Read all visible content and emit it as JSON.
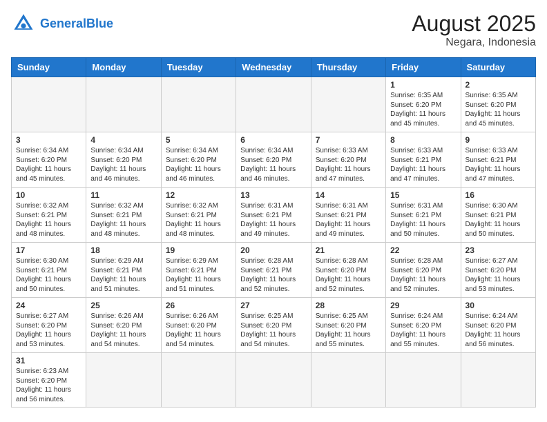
{
  "header": {
    "logo_general": "General",
    "logo_blue": "Blue",
    "month_year": "August 2025",
    "location": "Negara, Indonesia"
  },
  "weekdays": [
    "Sunday",
    "Monday",
    "Tuesday",
    "Wednesday",
    "Thursday",
    "Friday",
    "Saturday"
  ],
  "weeks": [
    [
      {
        "day": "",
        "sunrise": "",
        "sunset": "",
        "daylight": "",
        "empty": true
      },
      {
        "day": "",
        "sunrise": "",
        "sunset": "",
        "daylight": "",
        "empty": true
      },
      {
        "day": "",
        "sunrise": "",
        "sunset": "",
        "daylight": "",
        "empty": true
      },
      {
        "day": "",
        "sunrise": "",
        "sunset": "",
        "daylight": "",
        "empty": true
      },
      {
        "day": "",
        "sunrise": "",
        "sunset": "",
        "daylight": "",
        "empty": true
      },
      {
        "day": "1",
        "sunrise": "Sunrise: 6:35 AM",
        "sunset": "Sunset: 6:20 PM",
        "daylight": "Daylight: 11 hours and 45 minutes.",
        "empty": false
      },
      {
        "day": "2",
        "sunrise": "Sunrise: 6:35 AM",
        "sunset": "Sunset: 6:20 PM",
        "daylight": "Daylight: 11 hours and 45 minutes.",
        "empty": false
      }
    ],
    [
      {
        "day": "3",
        "sunrise": "Sunrise: 6:34 AM",
        "sunset": "Sunset: 6:20 PM",
        "daylight": "Daylight: 11 hours and 45 minutes.",
        "empty": false
      },
      {
        "day": "4",
        "sunrise": "Sunrise: 6:34 AM",
        "sunset": "Sunset: 6:20 PM",
        "daylight": "Daylight: 11 hours and 46 minutes.",
        "empty": false
      },
      {
        "day": "5",
        "sunrise": "Sunrise: 6:34 AM",
        "sunset": "Sunset: 6:20 PM",
        "daylight": "Daylight: 11 hours and 46 minutes.",
        "empty": false
      },
      {
        "day": "6",
        "sunrise": "Sunrise: 6:34 AM",
        "sunset": "Sunset: 6:20 PM",
        "daylight": "Daylight: 11 hours and 46 minutes.",
        "empty": false
      },
      {
        "day": "7",
        "sunrise": "Sunrise: 6:33 AM",
        "sunset": "Sunset: 6:20 PM",
        "daylight": "Daylight: 11 hours and 47 minutes.",
        "empty": false
      },
      {
        "day": "8",
        "sunrise": "Sunrise: 6:33 AM",
        "sunset": "Sunset: 6:21 PM",
        "daylight": "Daylight: 11 hours and 47 minutes.",
        "empty": false
      },
      {
        "day": "9",
        "sunrise": "Sunrise: 6:33 AM",
        "sunset": "Sunset: 6:21 PM",
        "daylight": "Daylight: 11 hours and 47 minutes.",
        "empty": false
      }
    ],
    [
      {
        "day": "10",
        "sunrise": "Sunrise: 6:32 AM",
        "sunset": "Sunset: 6:21 PM",
        "daylight": "Daylight: 11 hours and 48 minutes.",
        "empty": false
      },
      {
        "day": "11",
        "sunrise": "Sunrise: 6:32 AM",
        "sunset": "Sunset: 6:21 PM",
        "daylight": "Daylight: 11 hours and 48 minutes.",
        "empty": false
      },
      {
        "day": "12",
        "sunrise": "Sunrise: 6:32 AM",
        "sunset": "Sunset: 6:21 PM",
        "daylight": "Daylight: 11 hours and 48 minutes.",
        "empty": false
      },
      {
        "day": "13",
        "sunrise": "Sunrise: 6:31 AM",
        "sunset": "Sunset: 6:21 PM",
        "daylight": "Daylight: 11 hours and 49 minutes.",
        "empty": false
      },
      {
        "day": "14",
        "sunrise": "Sunrise: 6:31 AM",
        "sunset": "Sunset: 6:21 PM",
        "daylight": "Daylight: 11 hours and 49 minutes.",
        "empty": false
      },
      {
        "day": "15",
        "sunrise": "Sunrise: 6:31 AM",
        "sunset": "Sunset: 6:21 PM",
        "daylight": "Daylight: 11 hours and 50 minutes.",
        "empty": false
      },
      {
        "day": "16",
        "sunrise": "Sunrise: 6:30 AM",
        "sunset": "Sunset: 6:21 PM",
        "daylight": "Daylight: 11 hours and 50 minutes.",
        "empty": false
      }
    ],
    [
      {
        "day": "17",
        "sunrise": "Sunrise: 6:30 AM",
        "sunset": "Sunset: 6:21 PM",
        "daylight": "Daylight: 11 hours and 50 minutes.",
        "empty": false
      },
      {
        "day": "18",
        "sunrise": "Sunrise: 6:29 AM",
        "sunset": "Sunset: 6:21 PM",
        "daylight": "Daylight: 11 hours and 51 minutes.",
        "empty": false
      },
      {
        "day": "19",
        "sunrise": "Sunrise: 6:29 AM",
        "sunset": "Sunset: 6:21 PM",
        "daylight": "Daylight: 11 hours and 51 minutes.",
        "empty": false
      },
      {
        "day": "20",
        "sunrise": "Sunrise: 6:28 AM",
        "sunset": "Sunset: 6:21 PM",
        "daylight": "Daylight: 11 hours and 52 minutes.",
        "empty": false
      },
      {
        "day": "21",
        "sunrise": "Sunrise: 6:28 AM",
        "sunset": "Sunset: 6:20 PM",
        "daylight": "Daylight: 11 hours and 52 minutes.",
        "empty": false
      },
      {
        "day": "22",
        "sunrise": "Sunrise: 6:28 AM",
        "sunset": "Sunset: 6:20 PM",
        "daylight": "Daylight: 11 hours and 52 minutes.",
        "empty": false
      },
      {
        "day": "23",
        "sunrise": "Sunrise: 6:27 AM",
        "sunset": "Sunset: 6:20 PM",
        "daylight": "Daylight: 11 hours and 53 minutes.",
        "empty": false
      }
    ],
    [
      {
        "day": "24",
        "sunrise": "Sunrise: 6:27 AM",
        "sunset": "Sunset: 6:20 PM",
        "daylight": "Daylight: 11 hours and 53 minutes.",
        "empty": false
      },
      {
        "day": "25",
        "sunrise": "Sunrise: 6:26 AM",
        "sunset": "Sunset: 6:20 PM",
        "daylight": "Daylight: 11 hours and 54 minutes.",
        "empty": false
      },
      {
        "day": "26",
        "sunrise": "Sunrise: 6:26 AM",
        "sunset": "Sunset: 6:20 PM",
        "daylight": "Daylight: 11 hours and 54 minutes.",
        "empty": false
      },
      {
        "day": "27",
        "sunrise": "Sunrise: 6:25 AM",
        "sunset": "Sunset: 6:20 PM",
        "daylight": "Daylight: 11 hours and 54 minutes.",
        "empty": false
      },
      {
        "day": "28",
        "sunrise": "Sunrise: 6:25 AM",
        "sunset": "Sunset: 6:20 PM",
        "daylight": "Daylight: 11 hours and 55 minutes.",
        "empty": false
      },
      {
        "day": "29",
        "sunrise": "Sunrise: 6:24 AM",
        "sunset": "Sunset: 6:20 PM",
        "daylight": "Daylight: 11 hours and 55 minutes.",
        "empty": false
      },
      {
        "day": "30",
        "sunrise": "Sunrise: 6:24 AM",
        "sunset": "Sunset: 6:20 PM",
        "daylight": "Daylight: 11 hours and 56 minutes.",
        "empty": false
      }
    ],
    [
      {
        "day": "31",
        "sunrise": "Sunrise: 6:23 AM",
        "sunset": "Sunset: 6:20 PM",
        "daylight": "Daylight: 11 hours and 56 minutes.",
        "empty": false
      },
      {
        "day": "",
        "sunrise": "",
        "sunset": "",
        "daylight": "",
        "empty": true
      },
      {
        "day": "",
        "sunrise": "",
        "sunset": "",
        "daylight": "",
        "empty": true
      },
      {
        "day": "",
        "sunrise": "",
        "sunset": "",
        "daylight": "",
        "empty": true
      },
      {
        "day": "",
        "sunrise": "",
        "sunset": "",
        "daylight": "",
        "empty": true
      },
      {
        "day": "",
        "sunrise": "",
        "sunset": "",
        "daylight": "",
        "empty": true
      },
      {
        "day": "",
        "sunrise": "",
        "sunset": "",
        "daylight": "",
        "empty": true
      }
    ]
  ]
}
